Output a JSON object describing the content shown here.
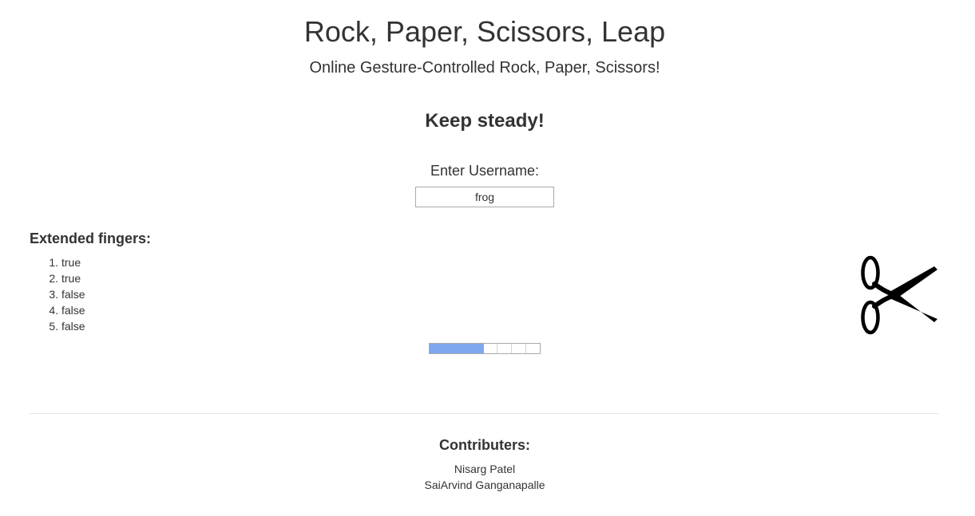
{
  "header": {
    "title": "Rock, Paper, Scissors, Leap",
    "subtitle": "Online Gesture-Controlled Rock, Paper, Scissors!"
  },
  "status": {
    "message": "Keep steady!"
  },
  "username": {
    "label": "Enter Username:",
    "value": "frog"
  },
  "fingers": {
    "heading": "Extended fingers:",
    "items": [
      "true",
      "true",
      "false",
      "false",
      "false"
    ]
  },
  "gesture": {
    "icon": "scissors-icon"
  },
  "progress": {
    "segments_total": 8,
    "segments_filled": 4,
    "fill_color": "#7ea7ee"
  },
  "footer": {
    "heading": "Contributers:",
    "contributors": [
      "Nisarg Patel",
      "SaiArvind Ganganapalle"
    ]
  }
}
